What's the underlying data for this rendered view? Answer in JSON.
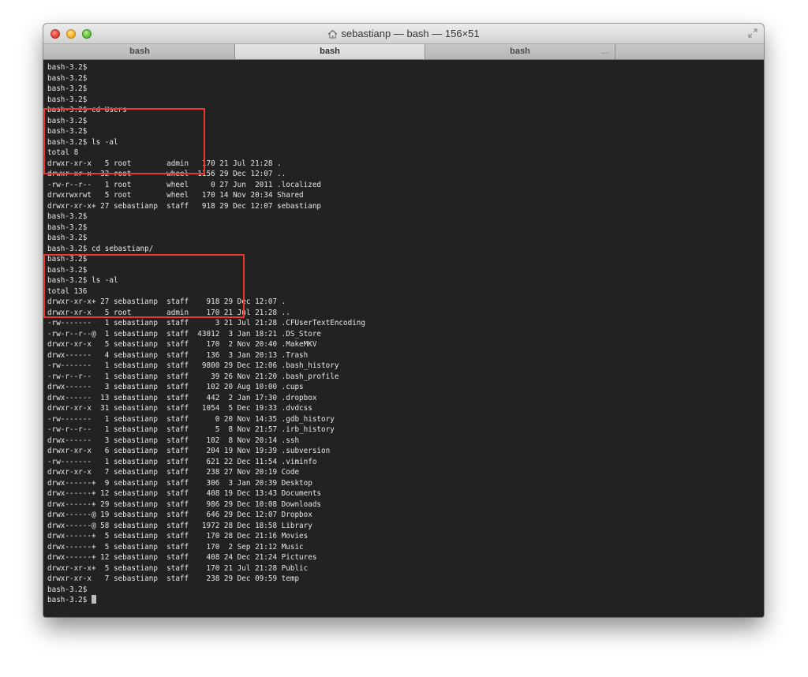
{
  "window": {
    "title": "sebastianp — bash — 156×51",
    "colors": {
      "highlight": "#e8392c",
      "terminal_bg": "#222222",
      "terminal_fg": "#e6e6e6"
    }
  },
  "tabs": [
    {
      "label": "bash",
      "active": false
    },
    {
      "label": "bash",
      "active": true
    },
    {
      "label": "bash",
      "active": false,
      "more": "..."
    }
  ],
  "terminal": {
    "lines": [
      "bash-3.2$",
      "bash-3.2$",
      "bash-3.2$",
      "bash-3.2$",
      "bash-3.2$ cd Users",
      "bash-3.2$",
      "bash-3.2$",
      "bash-3.2$ ls -al",
      "total 8",
      "drwxr-xr-x   5 root        admin   170 21 Jul 21:28 .",
      "drwxr-xr-x  32 root        wheel  1156 29 Dec 12:07 ..",
      "-rw-r--r--   1 root        wheel     0 27 Jun  2011 .localized",
      "drwxrwxrwt   5 root        wheel   170 14 Nov 20:34 Shared",
      "drwxr-xr-x+ 27 sebastianp  staff   918 29 Dec 12:07 sebastianp",
      "bash-3.2$",
      "bash-3.2$",
      "bash-3.2$",
      "bash-3.2$ cd sebastianp/",
      "bash-3.2$",
      "bash-3.2$",
      "bash-3.2$ ls -al",
      "total 136",
      "drwxr-xr-x+ 27 sebastianp  staff    918 29 Dec 12:07 .",
      "drwxr-xr-x   5 root        admin    170 21 Jul 21:28 ..",
      "-rw-------   1 sebastianp  staff      3 21 Jul 21:28 .CFUserTextEncoding",
      "-rw-r--r--@  1 sebastianp  staff  43012  3 Jan 18:21 .DS_Store",
      "drwxr-xr-x   5 sebastianp  staff    170  2 Nov 20:40 .MakeMKV",
      "drwx------   4 sebastianp  staff    136  3 Jan 20:13 .Trash",
      "-rw-------   1 sebastianp  staff   9800 29 Dec 12:06 .bash_history",
      "-rw-r--r--   1 sebastianp  staff     39 26 Nov 21:20 .bash_profile",
      "drwx------   3 sebastianp  staff    102 20 Aug 10:00 .cups",
      "drwx------  13 sebastianp  staff    442  2 Jan 17:30 .dropbox",
      "drwxr-xr-x  31 sebastianp  staff   1054  5 Dec 19:33 .dvdcss",
      "-rw-------   1 sebastianp  staff      0 20 Nov 14:35 .gdb_history",
      "-rw-r--r--   1 sebastianp  staff      5  8 Nov 21:57 .irb_history",
      "drwx------   3 sebastianp  staff    102  8 Nov 20:14 .ssh",
      "drwxr-xr-x   6 sebastianp  staff    204 19 Nov 19:39 .subversion",
      "-rw-------   1 sebastianp  staff    621 22 Dec 11:54 .viminfo",
      "drwxr-xr-x   7 sebastianp  staff    238 27 Nov 20:19 Code",
      "drwx------+  9 sebastianp  staff    306  3 Jan 20:39 Desktop",
      "drwx------+ 12 sebastianp  staff    408 19 Dec 13:43 Documents",
      "drwx------+ 29 sebastianp  staff    986 29 Dec 10:08 Downloads",
      "drwx------@ 19 sebastianp  staff    646 29 Dec 12:07 Dropbox",
      "drwx------@ 58 sebastianp  staff   1972 28 Dec 18:58 Library",
      "drwx------+  5 sebastianp  staff    170 28 Dec 21:16 Movies",
      "drwx------+  5 sebastianp  staff    170  2 Sep 21:12 Music",
      "drwx------+ 12 sebastianp  staff    408 24 Dec 21:24 Pictures",
      "drwxr-xr-x+  5 sebastianp  staff    170 21 Jul 21:28 Public",
      "drwxr-xr-x   7 sebastianp  staff    238 29 Dec 09:59 temp",
      "bash-3.2$",
      "bash-3.2$ "
    ]
  }
}
